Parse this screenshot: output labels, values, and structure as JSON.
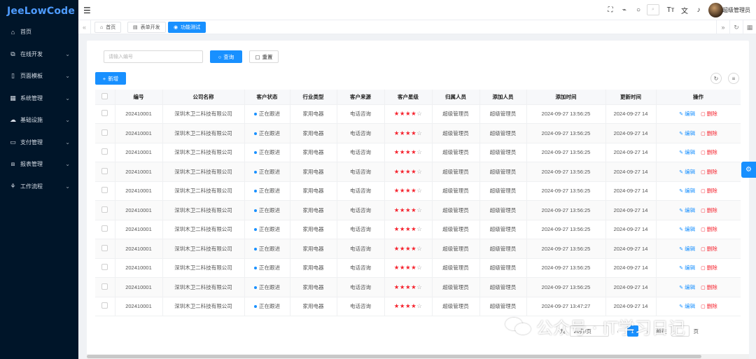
{
  "app": {
    "logo": "JeeLowCode"
  },
  "sidebar": {
    "items": [
      {
        "label": "首页",
        "icon": "home-icon",
        "glyph": "⌂",
        "has_children": false
      },
      {
        "label": "在线开发",
        "icon": "code-icon",
        "glyph": "⧉",
        "has_children": true
      },
      {
        "label": "页面模板",
        "icon": "template-icon",
        "glyph": "▯",
        "has_children": true
      },
      {
        "label": "系统管理",
        "icon": "system-icon",
        "glyph": "▦",
        "has_children": true
      },
      {
        "label": "基础设施",
        "icon": "infra-icon",
        "glyph": "☁",
        "has_children": true
      },
      {
        "label": "支付管理",
        "icon": "payment-icon",
        "glyph": "▭",
        "has_children": true
      },
      {
        "label": "报表管理",
        "icon": "report-icon",
        "glyph": "⧈",
        "has_children": true
      },
      {
        "label": "工作流程",
        "icon": "workflow-icon",
        "glyph": "⚘",
        "has_children": true
      }
    ]
  },
  "header": {
    "username": "超级管理员",
    "icons": [
      "fullscreen-icon",
      "broom-icon",
      "search-icon",
      "font-size-icon",
      "translate-icon",
      "bell-icon"
    ]
  },
  "tabs": [
    {
      "label": "首页",
      "icon": "home-icon",
      "active": false
    },
    {
      "label": "表单开发",
      "icon": "form-icon",
      "active": false
    },
    {
      "label": "功能测试",
      "icon": "eye-icon",
      "active": true
    }
  ],
  "search": {
    "placeholder": "请输入编号",
    "query_label": "查询",
    "reset_label": "重置"
  },
  "toolbar": {
    "add_label": "新增"
  },
  "table": {
    "columns": [
      "编号",
      "公司名称",
      "客户状态",
      "行业类型",
      "客户来源",
      "客户星级",
      "归属人员",
      "添加人员",
      "添加时间",
      "更新时间",
      "操作"
    ],
    "edit_label": "编辑",
    "delete_label": "删除",
    "rows": [
      {
        "id": "202410001",
        "company": "深圳木卫二科技有限公司",
        "status": "正在跟进",
        "industry": "家用电器",
        "source": "电话咨询",
        "stars": 4,
        "owner": "超级管理员",
        "creator": "超级管理员",
        "created": "2024-09-27 13:56:25",
        "updated": "2024-09-27 14"
      },
      {
        "id": "202410001",
        "company": "深圳木卫二科技有限公司",
        "status": "正在跟进",
        "industry": "家用电器",
        "source": "电话咨询",
        "stars": 4,
        "owner": "超级管理员",
        "creator": "超级管理员",
        "created": "2024-09-27 13:56:25",
        "updated": "2024-09-27 14"
      },
      {
        "id": "202410001",
        "company": "深圳木卫二科技有限公司",
        "status": "正在跟进",
        "industry": "家用电器",
        "source": "电话咨询",
        "stars": 4,
        "owner": "超级管理员",
        "creator": "超级管理员",
        "created": "2024-09-27 13:56:25",
        "updated": "2024-09-27 14"
      },
      {
        "id": "202410001",
        "company": "深圳木卫二科技有限公司",
        "status": "正在跟进",
        "industry": "家用电器",
        "source": "电话咨询",
        "stars": 4,
        "owner": "超级管理员",
        "creator": "超级管理员",
        "created": "2024-09-27 13:56:25",
        "updated": "2024-09-27 14"
      },
      {
        "id": "202410001",
        "company": "深圳木卫二科技有限公司",
        "status": "正在跟进",
        "industry": "家用电器",
        "source": "电话咨询",
        "stars": 4,
        "owner": "超级管理员",
        "creator": "超级管理员",
        "created": "2024-09-27 13:56:25",
        "updated": "2024-09-27 14"
      },
      {
        "id": "202410001",
        "company": "深圳木卫二科技有限公司",
        "status": "正在跟进",
        "industry": "家用电器",
        "source": "电话咨询",
        "stars": 4,
        "owner": "超级管理员",
        "creator": "超级管理员",
        "created": "2024-09-27 13:56:25",
        "updated": "2024-09-27 14"
      },
      {
        "id": "202410001",
        "company": "深圳木卫二科技有限公司",
        "status": "正在跟进",
        "industry": "家用电器",
        "source": "电话咨询",
        "stars": 4,
        "owner": "超级管理员",
        "creator": "超级管理员",
        "created": "2024-09-27 13:56:25",
        "updated": "2024-09-27 14"
      },
      {
        "id": "202410001",
        "company": "深圳木卫二科技有限公司",
        "status": "正在跟进",
        "industry": "家用电器",
        "source": "电话咨询",
        "stars": 4,
        "owner": "超级管理员",
        "creator": "超级管理员",
        "created": "2024-09-27 13:56:25",
        "updated": "2024-09-27 14"
      },
      {
        "id": "202410001",
        "company": "深圳木卫二科技有限公司",
        "status": "正在跟进",
        "industry": "家用电器",
        "source": "电话咨询",
        "stars": 4,
        "owner": "超级管理员",
        "creator": "超级管理员",
        "created": "2024-09-27 13:56:25",
        "updated": "2024-09-27 14"
      },
      {
        "id": "202410001",
        "company": "深圳木卫二科技有限公司",
        "status": "正在跟进",
        "industry": "家用电器",
        "source": "电话咨询",
        "stars": 4,
        "owner": "超级管理员",
        "creator": "超级管理员",
        "created": "2024-09-27 13:56:25",
        "updated": "2024-09-27 14"
      },
      {
        "id": "202410001",
        "company": "深圳木卫二科技有限公司",
        "status": "正在跟进",
        "industry": "家用电器",
        "source": "电话咨询",
        "stars": 4,
        "owner": "超级管理员",
        "creator": "超级管理员",
        "created": "2024-09-27 13:47:27",
        "updated": "2024-09-27 14"
      }
    ]
  },
  "pagination": {
    "total_prefix": "共",
    "page_size": "20条/页",
    "current_page": "1",
    "jump_label": "前往",
    "page_suffix": "页"
  },
  "watermark": {
    "text": "公众号 · IT学习日记"
  },
  "colors": {
    "primary": "#1890ff",
    "sidebar_bg": "#001529",
    "danger": "#f5222d"
  }
}
